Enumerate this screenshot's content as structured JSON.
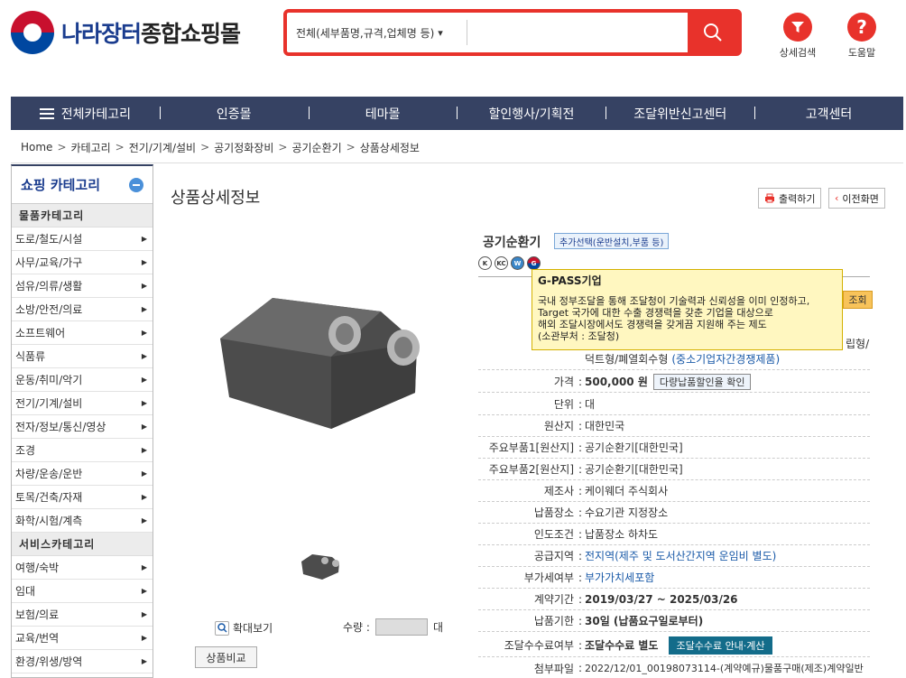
{
  "header": {
    "logo_text_1": "나라장터",
    "logo_text_2": "종합쇼핑몰",
    "search_scope": "전체(세부품명,규격,업체명 등)",
    "search_value": "",
    "detail_search_label": "상세검색",
    "help_label": "도움말"
  },
  "nav": {
    "items": [
      "전체카테고리",
      "인증몰",
      "테마몰",
      "할인행사/기획전",
      "조달위반신고센터",
      "고객센터"
    ]
  },
  "breadcrumb": [
    "Home",
    "카테고리",
    "전기/기계/설비",
    "공기정화장비",
    "공기순환기",
    "상품상세정보"
  ],
  "sidebar": {
    "title": "쇼핑 카테고리",
    "goods_section": "물품카테고리",
    "goods_items": [
      "도로/철도/시설",
      "사무/교육/가구",
      "섬유/의류/생활",
      "소방/안전/의료",
      "소프트웨어",
      "식품류",
      "운동/취미/악기",
      "전기/기계/설비",
      "전자/정보/통신/영상",
      "조경",
      "차량/운송/운반",
      "토목/건축/자재",
      "화학/시험/계측"
    ],
    "service_section": "서비스카테고리",
    "service_items": [
      "여행/숙박",
      "임대",
      "보험/의료",
      "교육/번역",
      "환경/위생/방역"
    ]
  },
  "main": {
    "page_title": "상품상세정보",
    "print_label": "출력하기",
    "back_label": "이전화면",
    "zoom_label": "확대보기",
    "qty_label": "수량 :",
    "qty_unit": "대",
    "compare_label": "상품비교"
  },
  "product": {
    "name": "공기순환기",
    "add_option": "추가선택(운반설치,부품 등)",
    "certs": [
      "K",
      "KC",
      "W",
      "G"
    ],
    "tooltip_title": "G-PASS기업",
    "tooltip_lines": [
      "국내 정부조달을 통해 조달청이 기술력과 신뢰성을 이미 인정하고,",
      "Target 국가에 대한 수출 경쟁력을 갖춘 기업을 대상으로",
      "해외 조달시장에서도 경쟁력을 갖게끔 지원해 주는 제도",
      "(소관부처 : 조달청)"
    ],
    "query_label": "조회",
    "spec_tail": "립형/",
    "spec_line": "덕트형/폐열회수형",
    "spec_tag": "(중소기업자간경쟁제품)",
    "price_label": "가격",
    "price_value": "500,000 원",
    "discount_label": "다량납품할인율 확인",
    "rows": [
      {
        "k": "단위",
        "v": "대"
      },
      {
        "k": "원산지",
        "v": "대한민국"
      },
      {
        "k": "주요부품1[원산지]",
        "v": "공기순환기[대한민국]"
      },
      {
        "k": "주요부품2[원산지]",
        "v": "공기순환기[대한민국]"
      },
      {
        "k": "제조사",
        "v": "케이웨더 주식회사"
      },
      {
        "k": "납품장소",
        "v": "수요기관 지정장소"
      },
      {
        "k": "인도조건",
        "v": "납품장소 하차도"
      }
    ],
    "supply_label": "공급지역",
    "supply_value": "전지역(제주 및 도서산간지역 운임비 별도)",
    "vat_label": "부가세여부",
    "vat_value": "부가가치세포함",
    "contract_label": "계약기간",
    "contract_value": "2019/03/27 ~ 2025/03/26",
    "deadline_label": "납품기한",
    "deadline_value": "30일 (납품요구일로부터)",
    "fee_label": "조달수수료여부",
    "fee_value": "조달수수료 별도",
    "fee_btn": "조달수수료 안내·계산",
    "attach_label": "첨부파일",
    "attach_value": "2022/12/01_00198073114-(계약예규)물품구매(제조)계약일반"
  }
}
